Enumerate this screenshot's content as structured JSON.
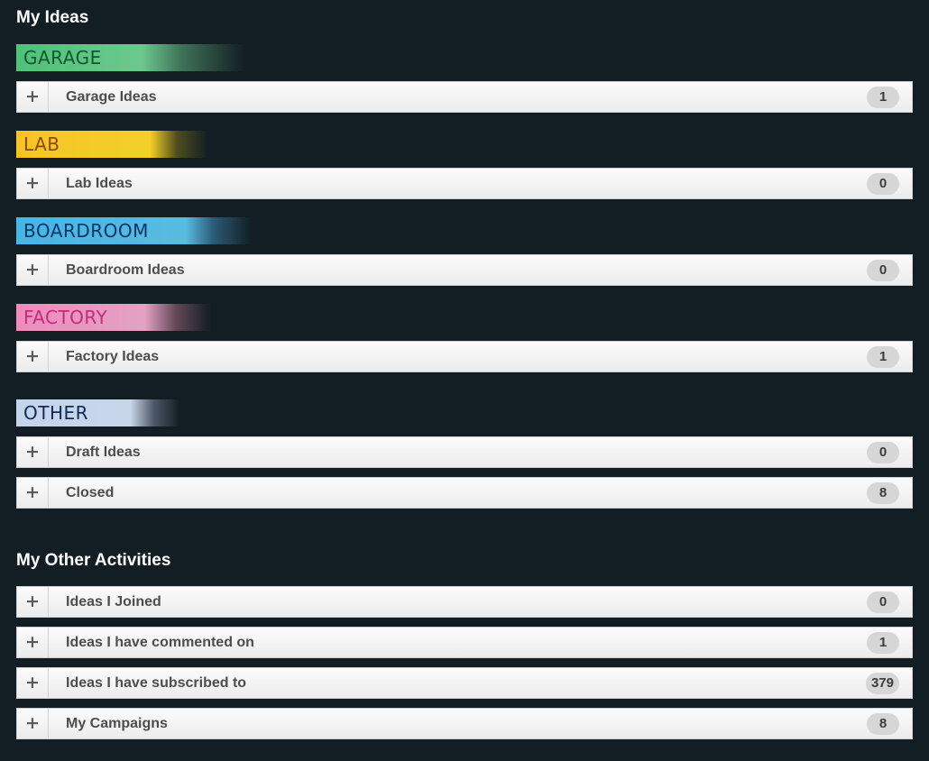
{
  "my_ideas": {
    "title": "My Ideas",
    "categories": [
      {
        "banner": "GARAGE",
        "items": [
          {
            "label": "Garage Ideas",
            "count": "1"
          }
        ]
      },
      {
        "banner": "LAB",
        "items": [
          {
            "label": "Lab Ideas",
            "count": "0"
          }
        ]
      },
      {
        "banner": "BOARDROOM",
        "items": [
          {
            "label": "Boardroom Ideas",
            "count": "0"
          }
        ]
      },
      {
        "banner": "FACTORY",
        "items": [
          {
            "label": "Factory Ideas",
            "count": "1"
          }
        ]
      },
      {
        "banner": "OTHER",
        "items": [
          {
            "label": "Draft Ideas",
            "count": "0"
          },
          {
            "label": "Closed",
            "count": "8"
          }
        ]
      }
    ]
  },
  "other_activities": {
    "title": "My Other Activities",
    "items": [
      {
        "label": "Ideas I Joined",
        "count": "0"
      },
      {
        "label": "Ideas I have commented on",
        "count": "1"
      },
      {
        "label": "Ideas I have subscribed to",
        "count": "379"
      },
      {
        "label": "My Campaigns",
        "count": "8"
      }
    ]
  },
  "expand_icon": "plus-icon",
  "colors": {
    "background": "#131e24",
    "garage": "#4fc17a",
    "lab": "#f6c425",
    "boardroom": "#4cb8e4",
    "factory": "#ef8cb8",
    "other": "#c8d6ea"
  }
}
